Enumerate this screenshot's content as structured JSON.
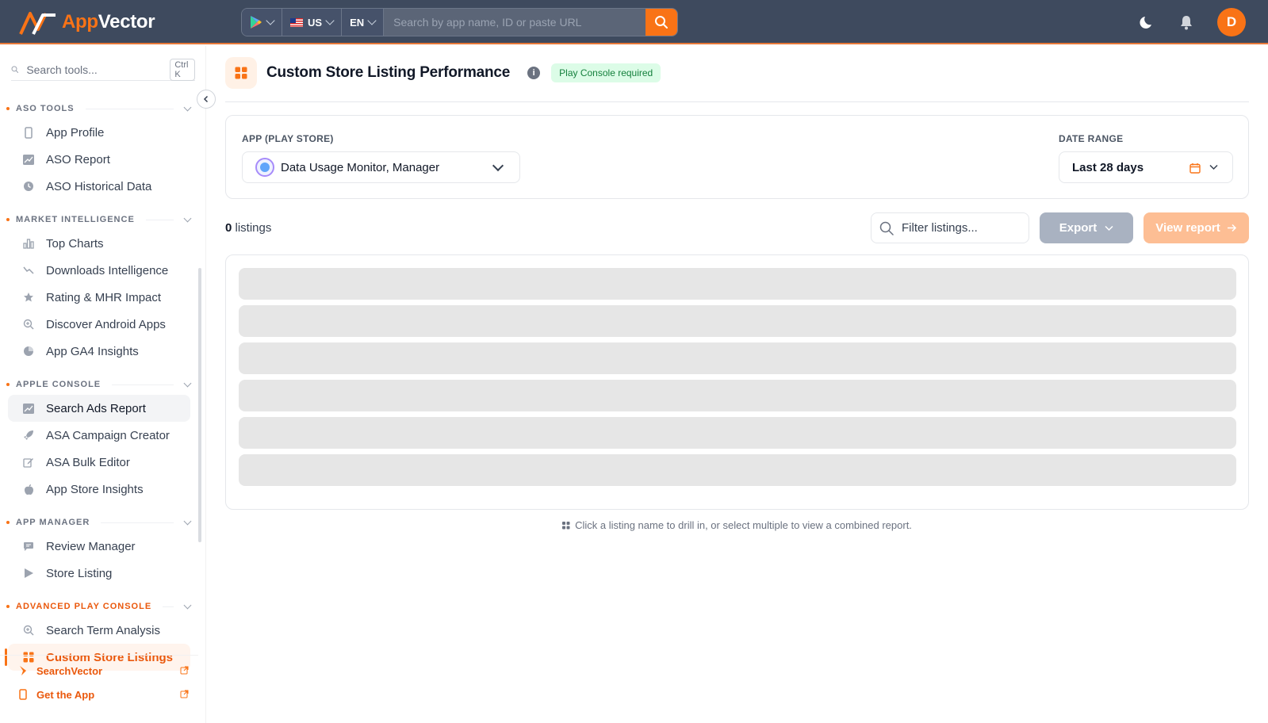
{
  "brand": {
    "app": "App",
    "vector": "Vector"
  },
  "topbar": {
    "store_icon": "google-play-icon",
    "country": "US",
    "language": "EN",
    "search_placeholder": "Search by app name, ID or paste URL",
    "avatar_initial": "D",
    "accent": "#f97316"
  },
  "sidebar": {
    "search_placeholder": "Search tools...",
    "shortcut": "Ctrl K",
    "sections": [
      {
        "title": "ASO TOOLS",
        "items": [
          "App Profile",
          "ASO Report",
          "ASO Historical Data"
        ]
      },
      {
        "title": "MARKET INTELLIGENCE",
        "items": [
          "Top Charts",
          "Downloads Intelligence",
          "Rating & MHR Impact",
          "Discover Android Apps",
          "App GA4 Insights"
        ]
      },
      {
        "title": "APPLE CONSOLE",
        "items": [
          "Search Ads Report",
          "ASA Campaign Creator",
          "ASA Bulk Editor",
          "App Store Insights"
        ]
      },
      {
        "title": "APP MANAGER",
        "items": [
          "Review Manager",
          "Store Listing"
        ]
      },
      {
        "title": "ADVANCED PLAY CONSOLE",
        "items": [
          "Search Term Analysis",
          "Custom Store Listings"
        ]
      }
    ],
    "footer": [
      "SearchVector",
      "Get the App"
    ]
  },
  "page": {
    "title": "Custom Store Listing Performance",
    "badge": "Play Console required",
    "app_label": "APP (PLAY STORE)",
    "app_value": "Data Usage Monitor, Manager",
    "date_label": "DATE RANGE",
    "date_value": "Last 28 days",
    "count": "0",
    "count_suffix": "listings",
    "filter_placeholder": "Filter listings...",
    "export_label": "Export",
    "view_label": "View report",
    "hint": "Click a listing name to drill in, or select multiple to view a combined report."
  }
}
